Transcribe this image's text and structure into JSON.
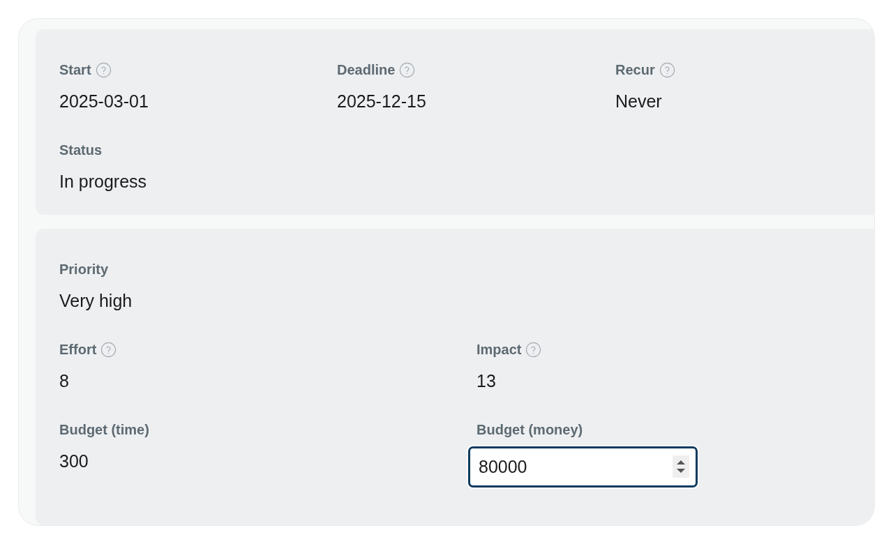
{
  "sections": [
    {
      "kind": "three_column",
      "fields": [
        {
          "label": "Start",
          "help": true,
          "kind": "text",
          "value": "2025-03-01"
        },
        {
          "label": "Deadline",
          "help": true,
          "kind": "text",
          "value": "2025-12-15"
        },
        {
          "label": "Recur",
          "help": true,
          "kind": "text",
          "value": "Never"
        },
        {
          "label": "Status",
          "help": false,
          "kind": "text",
          "value": "In progress"
        }
      ]
    },
    {
      "kind": "two_column",
      "fields": [
        {
          "label": "Priority",
          "help": false,
          "kind": "text",
          "value": "Very high"
        },
        {
          "label": "Effort",
          "help": true,
          "kind": "text",
          "value": "8"
        },
        {
          "label": "Impact",
          "help": true,
          "kind": "text",
          "value": "13"
        },
        {
          "label": "Budget (time)",
          "help": false,
          "kind": "text",
          "value": "300"
        },
        {
          "label": "Budget (money)",
          "help": false,
          "kind": "number_input",
          "value": "80000",
          "focused": true
        }
      ]
    }
  ]
}
